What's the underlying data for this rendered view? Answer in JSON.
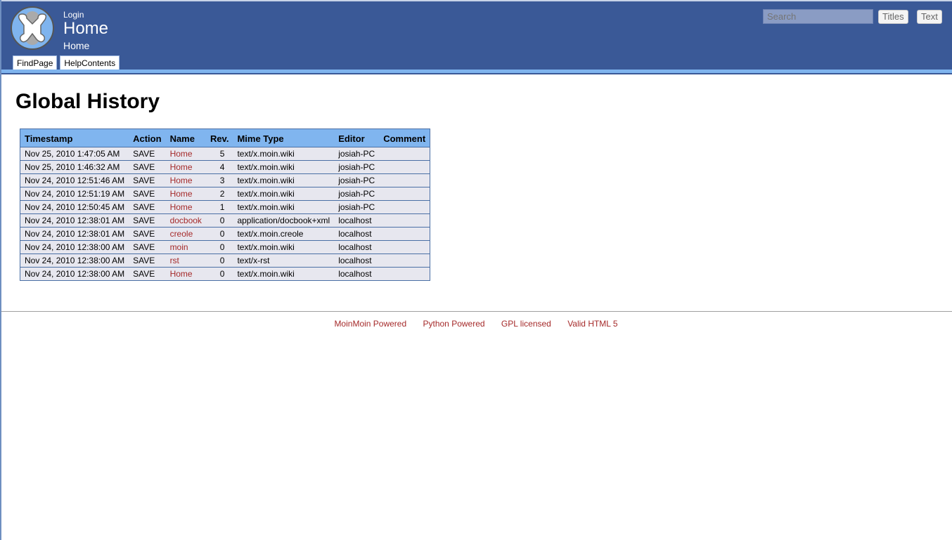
{
  "header": {
    "login_label": "Login",
    "site_title": "Home",
    "page_location": "Home",
    "tabs": [
      {
        "label": "FindPage"
      },
      {
        "label": "HelpContents"
      }
    ],
    "search": {
      "placeholder": "Search",
      "value": ""
    },
    "titles_button": "Titles",
    "text_button": "Text",
    "logo_icon": "moinmoin-logo-icon"
  },
  "main": {
    "title": "Global History",
    "table": {
      "columns": [
        "Timestamp",
        "Action",
        "Name",
        "Rev.",
        "Mime Type",
        "Editor",
        "Comment"
      ],
      "rows": [
        {
          "timestamp": "Nov 25, 2010 1:47:05 AM",
          "action": "SAVE",
          "name": "Home",
          "rev": "5",
          "mime": "text/x.moin.wiki",
          "editor": "josiah-PC",
          "comment": ""
        },
        {
          "timestamp": "Nov 25, 2010 1:46:32 AM",
          "action": "SAVE",
          "name": "Home",
          "rev": "4",
          "mime": "text/x.moin.wiki",
          "editor": "josiah-PC",
          "comment": ""
        },
        {
          "timestamp": "Nov 24, 2010 12:51:46 AM",
          "action": "SAVE",
          "name": "Home",
          "rev": "3",
          "mime": "text/x.moin.wiki",
          "editor": "josiah-PC",
          "comment": ""
        },
        {
          "timestamp": "Nov 24, 2010 12:51:19 AM",
          "action": "SAVE",
          "name": "Home",
          "rev": "2",
          "mime": "text/x.moin.wiki",
          "editor": "josiah-PC",
          "comment": ""
        },
        {
          "timestamp": "Nov 24, 2010 12:50:45 AM",
          "action": "SAVE",
          "name": "Home",
          "rev": "1",
          "mime": "text/x.moin.wiki",
          "editor": "josiah-PC",
          "comment": ""
        },
        {
          "timestamp": "Nov 24, 2010 12:38:01 AM",
          "action": "SAVE",
          "name": "docbook",
          "rev": "0",
          "mime": "application/docbook+xml",
          "editor": "localhost",
          "comment": ""
        },
        {
          "timestamp": "Nov 24, 2010 12:38:01 AM",
          "action": "SAVE",
          "name": "creole",
          "rev": "0",
          "mime": "text/x.moin.creole",
          "editor": "localhost",
          "comment": ""
        },
        {
          "timestamp": "Nov 24, 2010 12:38:00 AM",
          "action": "SAVE",
          "name": "moin",
          "rev": "0",
          "mime": "text/x.moin.wiki",
          "editor": "localhost",
          "comment": ""
        },
        {
          "timestamp": "Nov 24, 2010 12:38:00 AM",
          "action": "SAVE",
          "name": "rst",
          "rev": "0",
          "mime": "text/x-rst",
          "editor": "localhost",
          "comment": ""
        },
        {
          "timestamp": "Nov 24, 2010 12:38:00 AM",
          "action": "SAVE",
          "name": "Home",
          "rev": "0",
          "mime": "text/x.moin.wiki",
          "editor": "localhost",
          "comment": ""
        }
      ]
    }
  },
  "footer": {
    "links": [
      {
        "label": "MoinMoin Powered"
      },
      {
        "label": "Python Powered"
      },
      {
        "label": "GPL licensed"
      },
      {
        "label": "Valid HTML 5"
      }
    ]
  },
  "colors": {
    "header_bg": "#3a5997",
    "stripe": "#7fb4ee",
    "table_header_bg": "#80b5ef",
    "row_bg": "#e7e7ef",
    "link": "#a52a2a"
  }
}
